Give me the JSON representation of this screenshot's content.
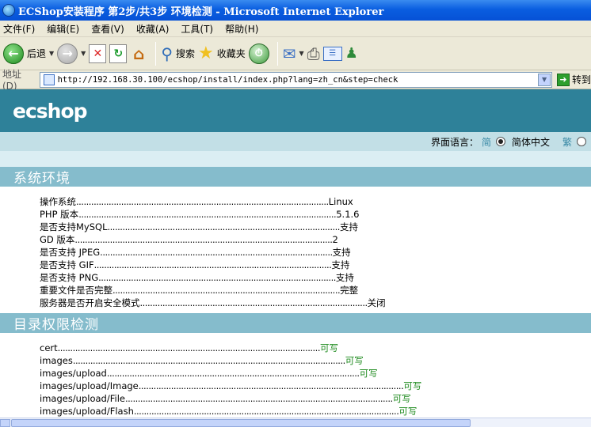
{
  "window": {
    "title": "ECShop安装程序 第2步/共3步 环境检测 - Microsoft Internet Explorer"
  },
  "menu": [
    "文件(F)",
    "编辑(E)",
    "查看(V)",
    "收藏(A)",
    "工具(T)",
    "帮助(H)"
  ],
  "toolbar": {
    "back_label": "后退",
    "search_label": "搜索",
    "favorites_label": "收藏夹"
  },
  "address": {
    "label": "地址(D)",
    "url": "http://192.168.30.100/ecshop/install/index.php?lang=zh_cn&step=check",
    "go_label": "转到"
  },
  "page": {
    "logo": "ecshop",
    "lang_label": "界面语言：",
    "lang_simplified_glyph": "简",
    "lang_simplified": "简体中文",
    "lang_traditional_glyph": "繁",
    "sections": [
      {
        "title": "系统环境",
        "rows": [
          {
            "name": "操作系统",
            "dots": ".....................................................................................................",
            "value": "Linux"
          },
          {
            "name": "PHP 版本",
            "dots": ".......................................................................................................",
            "value": "5.1.6"
          },
          {
            "name": "是否支持MySQL",
            "dots": ".............................................................................................",
            "value": "支持"
          },
          {
            "name": "GD 版本",
            "dots": ".......................................................................................................",
            "value": "2"
          },
          {
            "name": "是否支持 JPEG",
            "dots": ".............................................................................................",
            "value": "支持"
          },
          {
            "name": "是否支持 GIF",
            "dots": "...............................................................................................",
            "value": "支持"
          },
          {
            "name": "是否支持 PNG",
            "dots": "...............................................................................................",
            "value": "支持"
          },
          {
            "name": "重要文件是否完整",
            "dots": "...........................................................................................",
            "value": "完整"
          },
          {
            "name": "服务器是否开启安全模式",
            "dots": "...........................................................................................",
            "value": "关闭"
          }
        ]
      },
      {
        "title": "目录权限检测",
        "rows": [
          {
            "name": "cert",
            "dots": ".........................................................................................................",
            "value": "可写"
          },
          {
            "name": "images",
            "dots": ".............................................................................................................",
            "value": "可写"
          },
          {
            "name": "images/upload",
            "dots": ".....................................................................................................",
            "value": "可写"
          },
          {
            "name": "images/upload/Image",
            "dots": "..........................................................................................................",
            "value": "可写"
          },
          {
            "name": "images/upload/File",
            "dots": "...........................................................................................................",
            "value": "可写"
          },
          {
            "name": "images/upload/Flash",
            "dots": "..........................................................................................................",
            "value": "可写"
          }
        ]
      }
    ]
  }
}
